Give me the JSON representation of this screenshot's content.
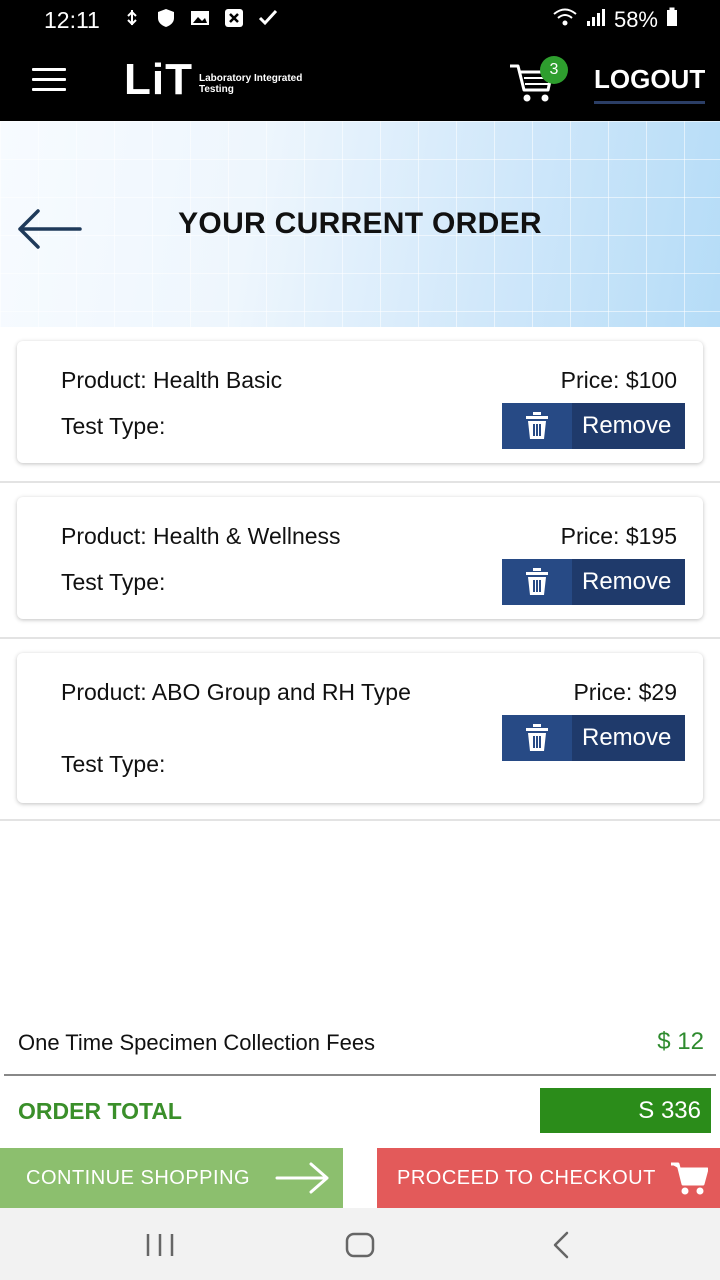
{
  "status_bar": {
    "time": "12:11",
    "battery": "58%"
  },
  "header": {
    "logo_text": "LiT",
    "logo_sub_line1": "Laboratory Integrated",
    "logo_sub_line2": "Testing",
    "cart_count": "3",
    "logout_label": "LOGOUT"
  },
  "page": {
    "title": "YOUR CURRENT ORDER"
  },
  "orders": [
    {
      "product": "Product: Health Basic",
      "price": "Price: $100",
      "test_type": "Test Type:",
      "remove_label": "Remove"
    },
    {
      "product": "Product: Health &  Wellness",
      "price": "Price: $195",
      "test_type": "Test Type:",
      "remove_label": "Remove"
    },
    {
      "product": "Product: ABO Group and RH Type",
      "price": "Price: $29",
      "test_type": "Test Type:",
      "remove_label": "Remove"
    }
  ],
  "fees": {
    "label": "One Time Specimen Collection Fees",
    "value": "$ 12"
  },
  "total": {
    "label": "ORDER TOTAL",
    "value": "S 336"
  },
  "actions": {
    "continue_label": "CONTINUE SHOPPING",
    "checkout_label": "PROCEED TO CHECKOUT"
  },
  "colors": {
    "header_bg": "#000000",
    "remove_btn": "#1f3a6b",
    "total_green": "#2b8c1a",
    "continue_green": "#8cbf6e",
    "checkout_red": "#e35a5a"
  },
  "icons": {
    "menu": "hamburger-icon",
    "cart": "cart-icon",
    "back": "back-arrow-icon",
    "remove": "trash-icon",
    "continue": "arrow-right-icon",
    "checkout": "cart-icon"
  }
}
